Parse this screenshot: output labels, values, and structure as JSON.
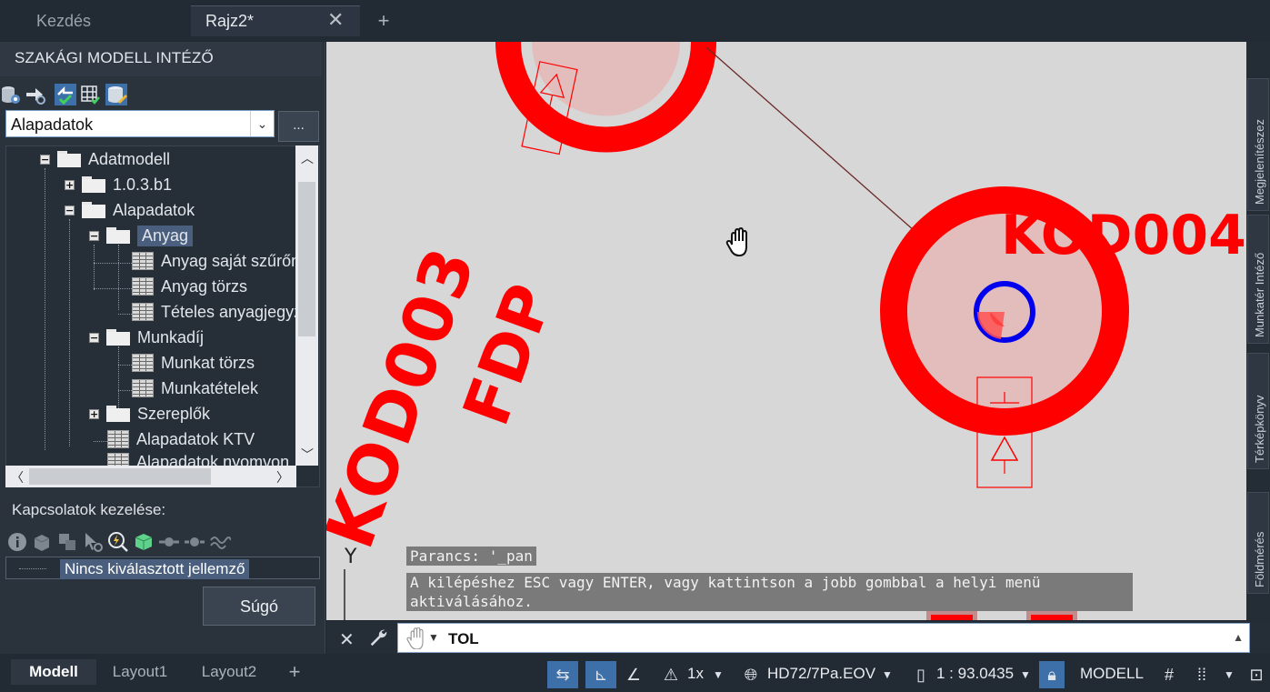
{
  "tabs": [
    {
      "label": "Kezdés"
    },
    {
      "label": "Rajz2*"
    }
  ],
  "panel": {
    "title": "SZAKÁGI MODELL INTÉZŐ",
    "combo_value": "Alapadatok",
    "ellipsis_label": "...",
    "tree": [
      {
        "label": "Adatmodell"
      },
      {
        "label": "1.0.3.b1"
      },
      {
        "label": "Alapadatok"
      },
      {
        "label": "Anyag"
      },
      {
        "label": "Anyag saját szűrőm"
      },
      {
        "label": "Anyag törzs"
      },
      {
        "label": "Tételes anyagjegyzé"
      },
      {
        "label": "Munkadíj"
      },
      {
        "label": "Munkat törzs"
      },
      {
        "label": "Munkatételek"
      },
      {
        "label": "Szereplők"
      },
      {
        "label": "Alapadatok KTV"
      },
      {
        "label": "Alapadatok nyomvon"
      }
    ],
    "connections_label": "Kapcsolatok kezelése:",
    "feature_text": "Nincs kiválasztott jellemző",
    "help_button": "Súgó"
  },
  "drawing": {
    "label_kod003": "KOD003",
    "label_fdp": "FDP",
    "label_kod004": "KOD004",
    "axis_y": "Y",
    "history": [
      "Parancs: '_pan",
      "A kilépéshez ESC vagy ENTER, vagy kattintson a jobb gombbal a helyi menü",
      "aktiválásához."
    ]
  },
  "right_tabs": [
    {
      "label": "Megjelenítészez"
    },
    {
      "label": "Munkatér Intéző"
    },
    {
      "label": "Térképkönyv"
    },
    {
      "label": "Földmérés"
    }
  ],
  "command": {
    "value": "TOL"
  },
  "status": {
    "layout_tabs": [
      {
        "label": "Modell"
      },
      {
        "label": "Layout1"
      },
      {
        "label": "Layout2"
      }
    ],
    "scale_factor": "1x",
    "coord_system": "HD72/7Pa.EOV",
    "scale": "1 : 93.0435",
    "space": "MODELL"
  },
  "colors": {
    "accent_blue": "#3d6fa8",
    "drawing_red": "#ff0000",
    "drawing_blue": "#0000ee",
    "canvas_bg": "#d7d7d7"
  }
}
